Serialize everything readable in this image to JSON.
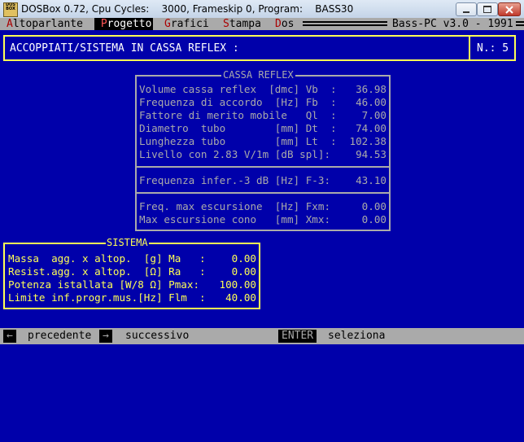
{
  "window": {
    "icon_text": "DOS BOX",
    "title": "DOSBox 0.72, Cpu Cycles:    3000, Frameskip 0, Program:    BASS30"
  },
  "menu": {
    "items": [
      {
        "label_hot": "A",
        "label_rest": "ltoparlante"
      },
      {
        "label_hot": "P",
        "label_rest": "rogetto"
      },
      {
        "label_hot": "G",
        "label_rest": "rafici"
      },
      {
        "label_hot": "S",
        "label_rest": "tampa"
      },
      {
        "label_hot": "D",
        "label_rest": "os"
      }
    ],
    "right_text": "Bass-PC v3.0 - 1991"
  },
  "header": {
    "title": "ACCOPPIATI/SISTEMA IN CASSA REFLEX :",
    "number": "N.: 5"
  },
  "cassa": {
    "title": "CASSA REFLEX",
    "rows": [
      {
        "label": "Volume cassa reflex  [dmc] Vb  :",
        "value": "36.98"
      },
      {
        "label": "Frequenza di accordo  [Hz] Fb  :",
        "value": "46.00"
      },
      {
        "label": "Fattore di merito mobile   Ql  :",
        "value": "7.00"
      },
      {
        "label": "Diametro  tubo        [mm] Dt  :",
        "value": "74.00"
      },
      {
        "label": "Lunghezza tubo        [mm] Lt  :",
        "value": "102.38"
      },
      {
        "label": "Livello con 2.83 V/1m [dB spl]:",
        "value": "94.53"
      },
      {
        "label": "Frequenza infer.-3 dB [Hz] F-3:",
        "value": "43.10"
      },
      {
        "label": "Freq. max escursione  [Hz] Fxm:",
        "value": "0.00"
      },
      {
        "label": "Max escursione cono   [mm] Xmx:",
        "value": "0.00"
      }
    ]
  },
  "sistema": {
    "title": "SISTEMA",
    "rows": [
      {
        "label": "Massa  agg. x altop.  [g] Ma   :",
        "value": "0.00"
      },
      {
        "label": "Resist.agg. x altop.  [Ω] Ra   :",
        "value": "0.00"
      },
      {
        "label": "Potenza istallata [W/8 Ω] Pmax:",
        "value": "100.00"
      },
      {
        "label": "Limite inf.progr.mus.[Hz] Flm  :",
        "value": "40.00"
      }
    ]
  },
  "status": {
    "prev_key": "←",
    "prev_label": "precedente",
    "next_key": "→",
    "next_label": "successivo",
    "enter_key": "ENTER",
    "enter_label": "seleziona"
  },
  "colors": {
    "background": "#0000aa",
    "box_gray": "#aaaaaa",
    "yellow": "#ffff55",
    "hotkey_red": "#aa0000"
  }
}
